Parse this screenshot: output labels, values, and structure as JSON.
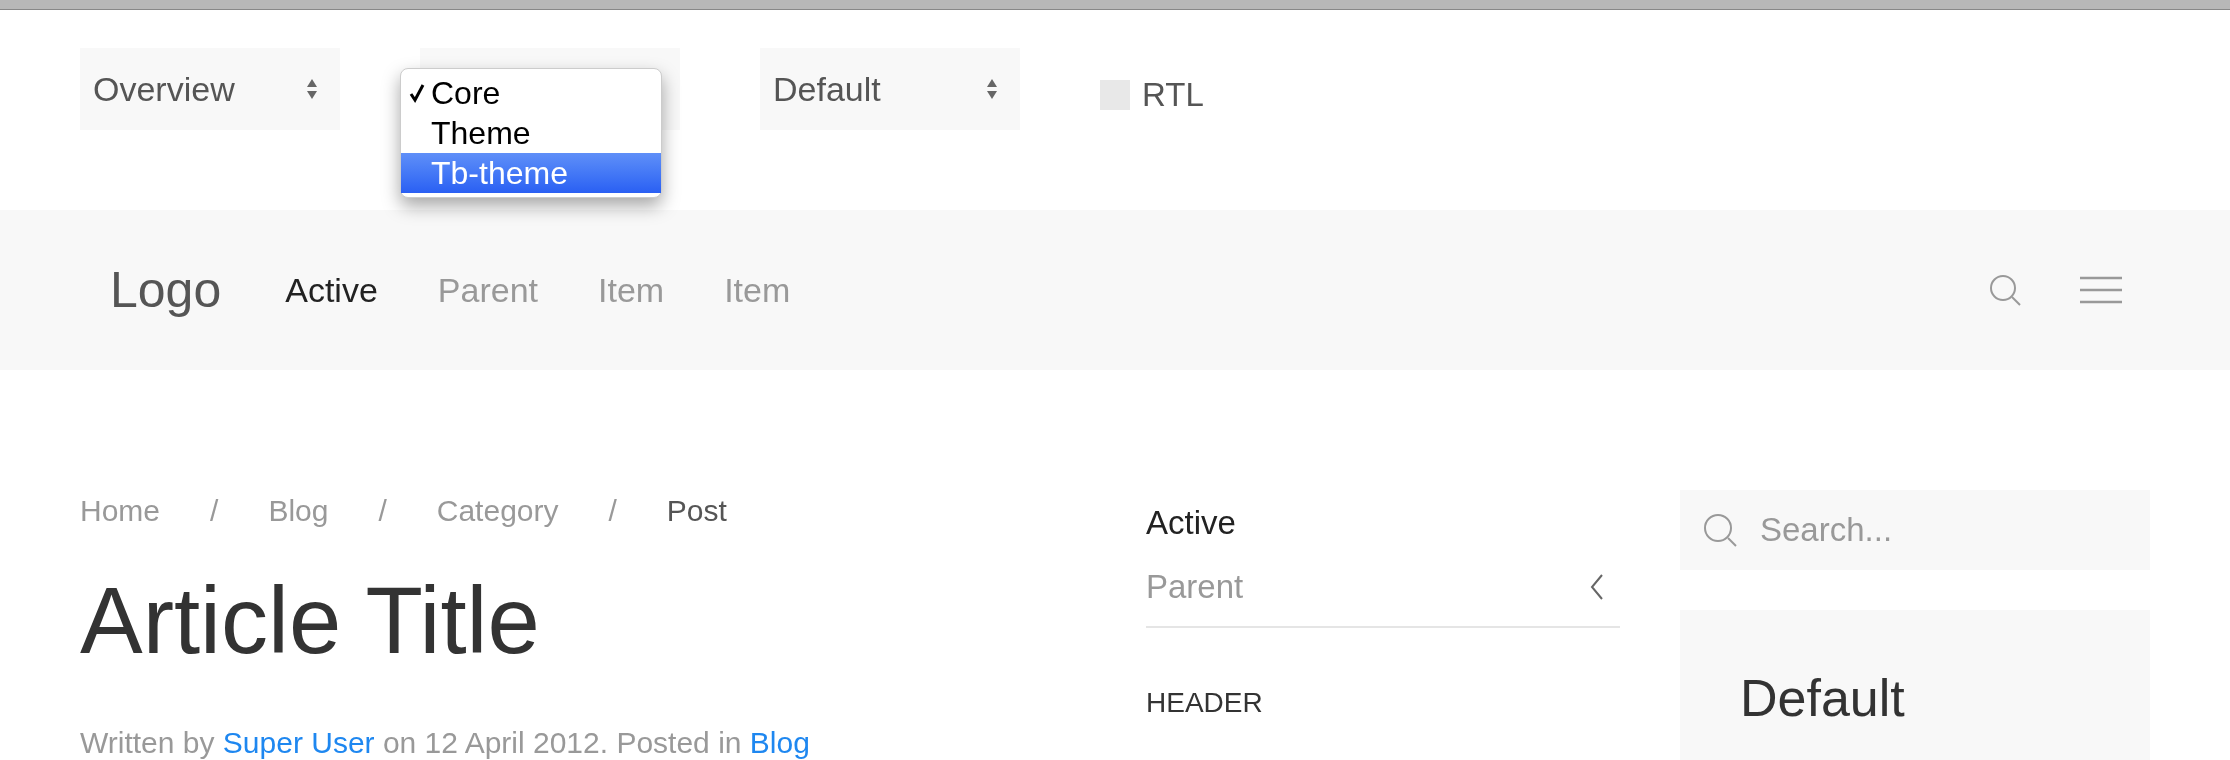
{
  "toolbar": {
    "selects": [
      {
        "kind": "select",
        "value": "Overview"
      },
      {
        "kind": "dropdown",
        "options": [
          {
            "label": "Core",
            "checked": true,
            "selected": false
          },
          {
            "label": "Theme",
            "checked": false,
            "selected": false
          },
          {
            "label": "Tb-theme",
            "checked": false,
            "selected": true
          }
        ]
      },
      {
        "kind": "select",
        "value": "Default"
      }
    ],
    "rtl": {
      "label": "RTL",
      "checked": false
    }
  },
  "navbar": {
    "logo": "Logo",
    "items": [
      {
        "label": "Active",
        "selected": true
      },
      {
        "label": "Parent",
        "selected": false
      },
      {
        "label": "Item",
        "selected": false
      },
      {
        "label": "Item",
        "selected": false
      }
    ]
  },
  "breadcrumbs": [
    {
      "label": "Home",
      "current": false
    },
    {
      "label": "Blog",
      "current": false
    },
    {
      "label": "Category",
      "current": false
    },
    {
      "label": "Post",
      "current": true
    }
  ],
  "breadcrumb_separator": "/",
  "article": {
    "title": "Article Title",
    "meta": [
      {
        "kind": "text",
        "text": "Written by "
      },
      {
        "kind": "link",
        "text": "Super User"
      },
      {
        "kind": "text",
        "text": " on 12 April 2012. Posted in "
      },
      {
        "kind": "link",
        "text": "Blog"
      }
    ]
  },
  "side_nav": {
    "items": [
      {
        "kind": "item",
        "label": "Active",
        "selected": true
      },
      {
        "kind": "parent",
        "label": "Parent",
        "selected": false
      },
      {
        "kind": "header",
        "label": "HEADER",
        "selected": false
      }
    ]
  },
  "search": {
    "placeholder": "Search..."
  },
  "card": {
    "title": "Default"
  }
}
